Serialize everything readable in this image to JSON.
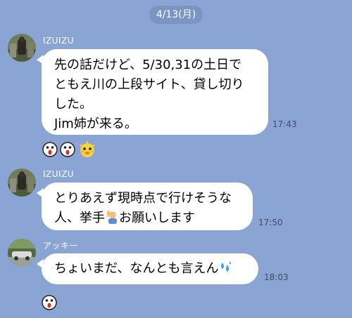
{
  "date_separator": "4/13(月)",
  "messages": [
    {
      "sender": "IZUIZU",
      "text": "先の話だけど、5/30,31の土日で\nともえ川の上段サイト、貸し切り\nした。\nJim姉が来る。",
      "time": "17:43",
      "reactions": [
        "shocked-face-icon",
        "shocked-face-icon",
        "surprised-chick-icon"
      ]
    },
    {
      "sender": "IZUIZU",
      "text_before_emoji": "とりあえず現時点で行けそうな\n人、挙手",
      "emoji": "raising-hand-icon",
      "text_after_emoji": "お願いします",
      "time": "17:50"
    },
    {
      "sender": "アッキー",
      "text_before_emoji": "ちょいまだ、なんとも言えん",
      "emoji": "sweat-droplets-icon",
      "time": "18:03",
      "reactions": [
        "shocked-face-icon"
      ]
    }
  ],
  "colors": {
    "background": "#8aa5d3",
    "bubble": "#ffffff",
    "time_text": "#3f4c63",
    "sender_text": "#ffffff"
  }
}
